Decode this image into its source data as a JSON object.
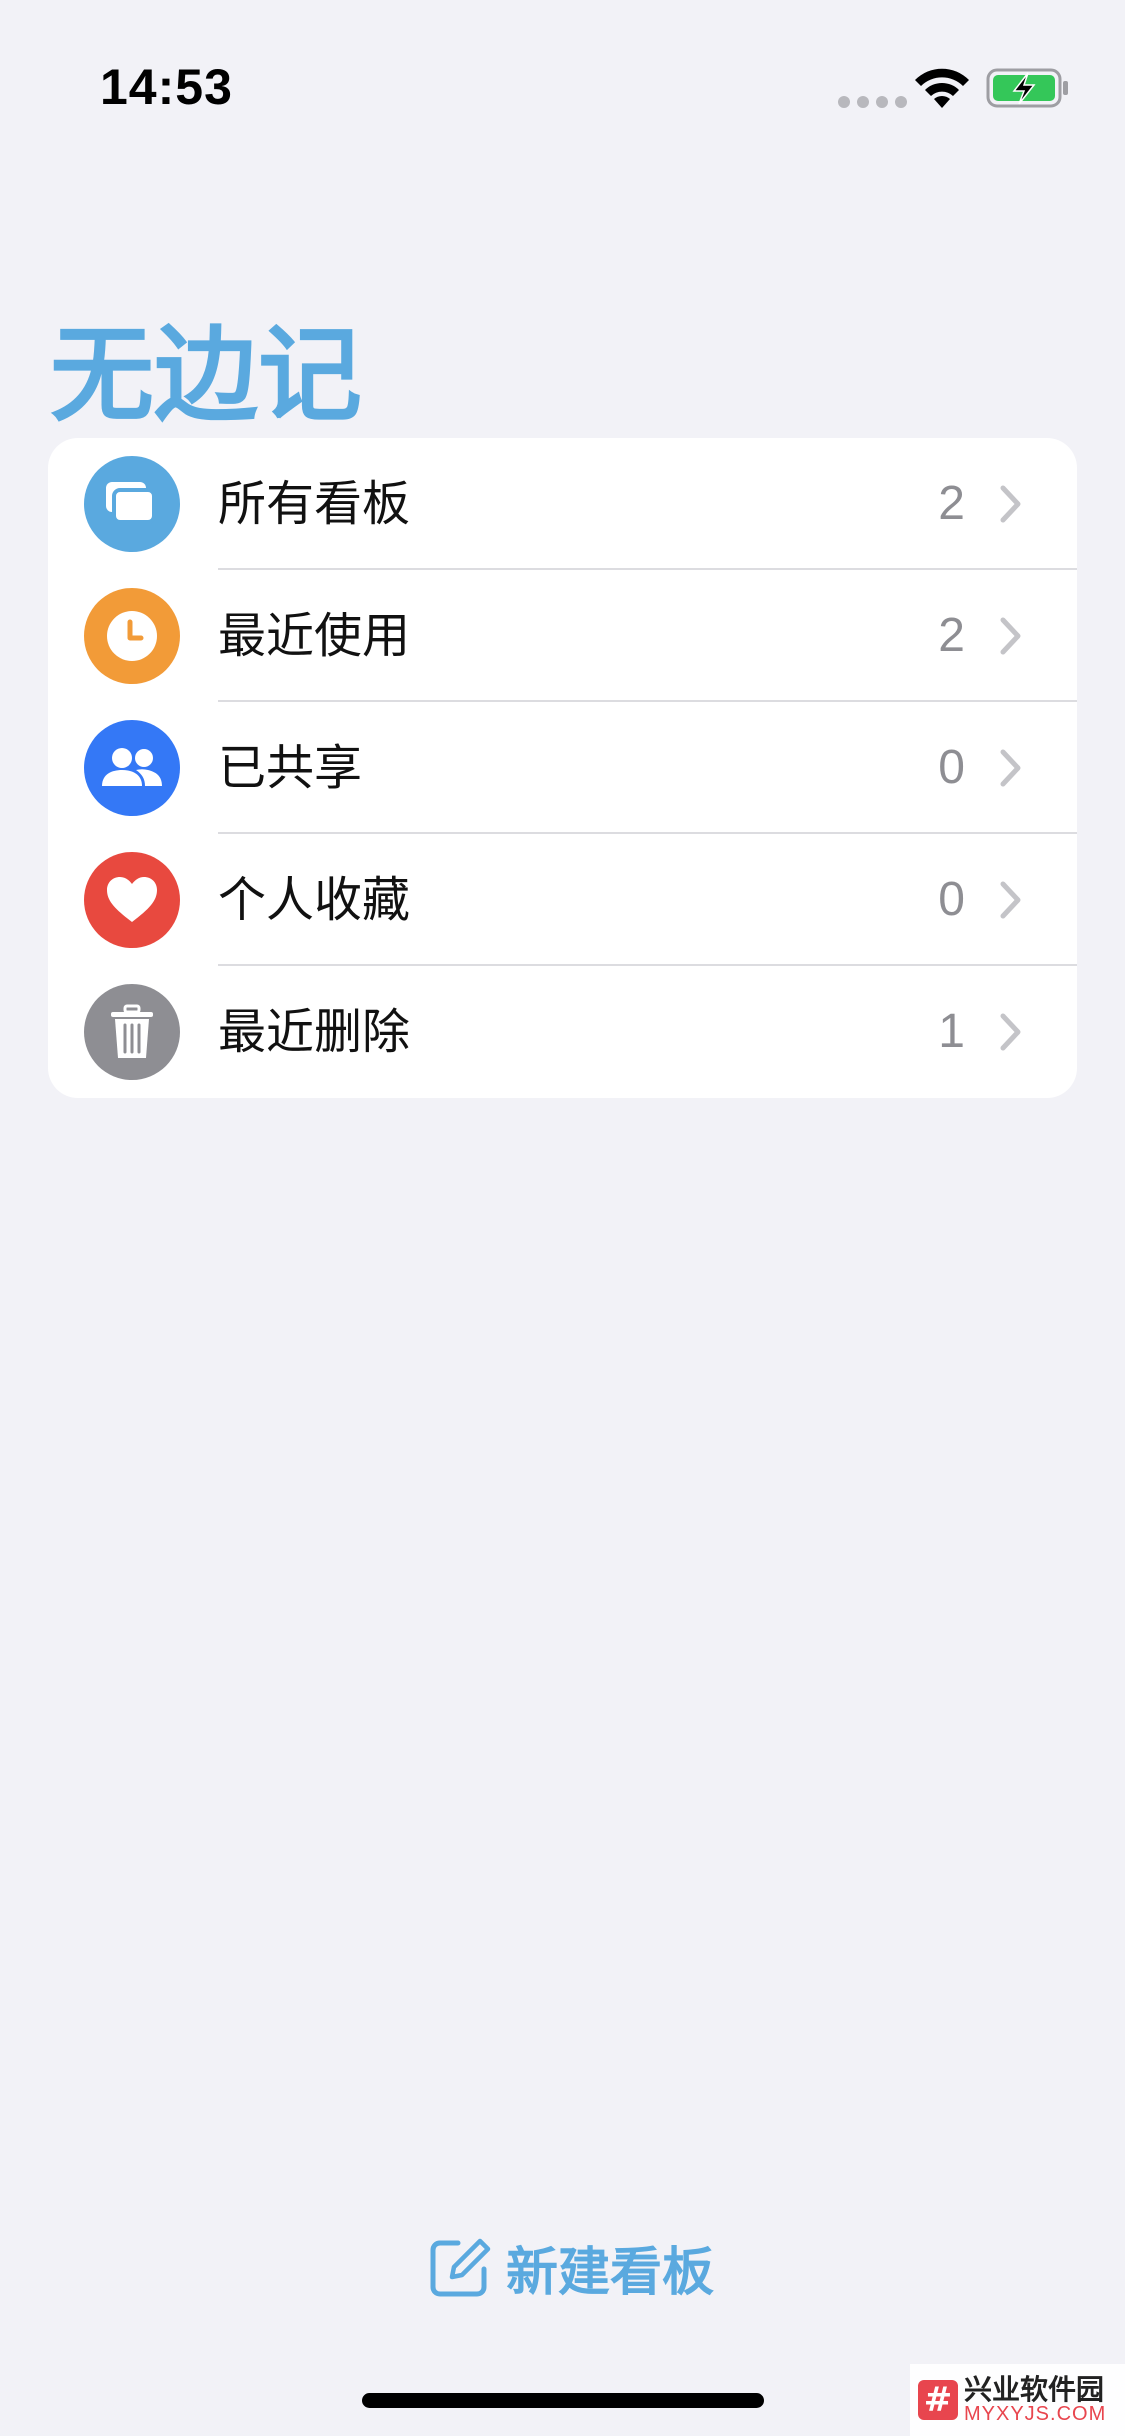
{
  "status_bar": {
    "time": "14:53"
  },
  "title": "无边记",
  "list": [
    {
      "label": "所有看板",
      "count": "2",
      "icon": "stacked-boards-icon",
      "color": "#5AA9DF"
    },
    {
      "label": "最近使用",
      "count": "2",
      "icon": "clock-icon",
      "color": "#F29B38"
    },
    {
      "label": "已共享",
      "count": "0",
      "icon": "people-icon",
      "color": "#3478F6"
    },
    {
      "label": "个人收藏",
      "count": "0",
      "icon": "heart-icon",
      "color": "#E8493F"
    },
    {
      "label": "最近删除",
      "count": "1",
      "icon": "trash-icon",
      "color": "#8E8E93"
    }
  ],
  "new_board_label": "新建看板",
  "watermark": {
    "name": "兴业软件园",
    "url": "MYXYJS.COM"
  }
}
